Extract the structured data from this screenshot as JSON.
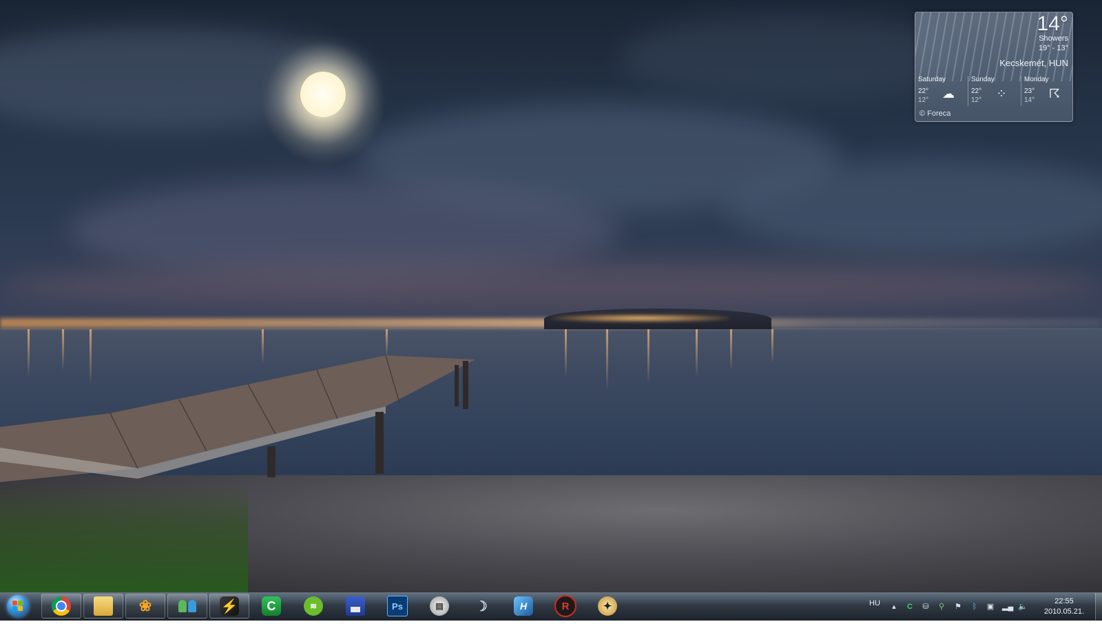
{
  "weather": {
    "temp": "14°",
    "condition": "Showers",
    "range": "19° - 13°",
    "city": "Kecskemét, HUN",
    "forecast": [
      {
        "day": "Saturday",
        "high": "22°",
        "low": "12°",
        "icon": "cloudy-icon"
      },
      {
        "day": "Sunday",
        "high": "22°",
        "low": "12°",
        "icon": "rain-icon"
      },
      {
        "day": "Monday",
        "high": "23°",
        "low": "14°",
        "icon": "thunderstorm-icon"
      }
    ],
    "credit": "© Foreca"
  },
  "taskbar": {
    "pinned": [
      {
        "name": "chrome-icon",
        "active": true
      },
      {
        "name": "explorer-icon",
        "active": true
      },
      {
        "name": "media-player-icon",
        "active": true
      },
      {
        "name": "messenger-icon",
        "active": true
      },
      {
        "name": "winamp-icon",
        "active": true
      },
      {
        "name": "client-c-icon",
        "active": false
      },
      {
        "name": "spotify-icon",
        "active": false
      },
      {
        "name": "floppy-save-icon",
        "active": false
      },
      {
        "name": "photoshop-icon",
        "label": "Ps",
        "active": false
      },
      {
        "name": "film-clapper-icon",
        "active": false
      },
      {
        "name": "moon-app-icon",
        "active": false
      },
      {
        "name": "app-h-icon",
        "active": false
      },
      {
        "name": "red-r-icon",
        "active": false
      },
      {
        "name": "counter-strike-icon",
        "active": false
      }
    ],
    "tray": {
      "language": "HU",
      "icons": [
        "show-hidden-icon",
        "green-c-icon",
        "network-share-icon",
        "usb-icon",
        "flag-icon",
        "bluetooth-icon",
        "device-icon",
        "signal-icon",
        "volume-icon"
      ]
    },
    "clock": {
      "time": "22:55",
      "date": "2010.05.21."
    }
  }
}
